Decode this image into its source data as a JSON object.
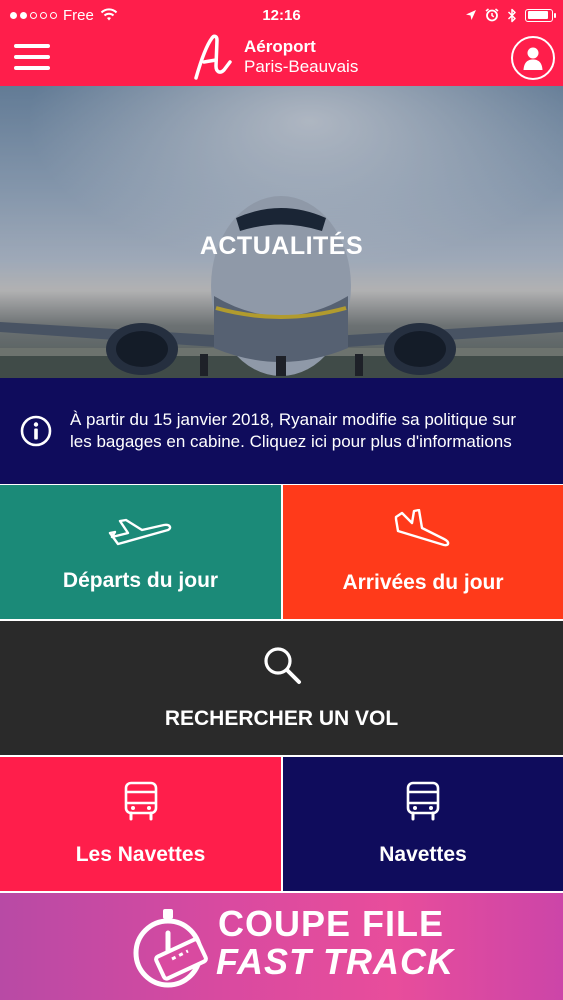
{
  "status_bar": {
    "carrier": "Free",
    "time": "12:16"
  },
  "header": {
    "title": "Aéroport",
    "subtitle": "Paris-Beauvais"
  },
  "hero": {
    "title": "ACTUALITÉS"
  },
  "notice": {
    "text": "À partir du 15 janvier 2018, Ryanair modifie sa politique sur les bagages en cabine. Cliquez ici pour plus d'informations"
  },
  "tiles": {
    "departures": "Départs du jour",
    "arrivals": "Arrivées du jour",
    "search": "RECHERCHER UN VOL",
    "shuttles_1": "Les Navettes",
    "shuttles_2": "Navettes"
  },
  "banner": {
    "line1": "COUPE FILE",
    "line2": "FAST TRACK"
  },
  "colors": {
    "brand_red": "#ff1e4b",
    "navy": "#0f0c5c",
    "teal": "#1b8a78",
    "orange": "#ff3a1a",
    "dark": "#2a2a2a",
    "banner_pink": "#e84d9b"
  },
  "icons": [
    "signal-dots-icon",
    "wifi-icon",
    "location-arrow-icon",
    "alarm-icon",
    "bluetooth-icon",
    "battery-icon",
    "menu-icon",
    "airport-logo-icon",
    "user-icon",
    "info-icon",
    "departure-plane-icon",
    "arrival-plane-icon",
    "search-icon",
    "bus-icon",
    "fast-track-icon"
  ]
}
